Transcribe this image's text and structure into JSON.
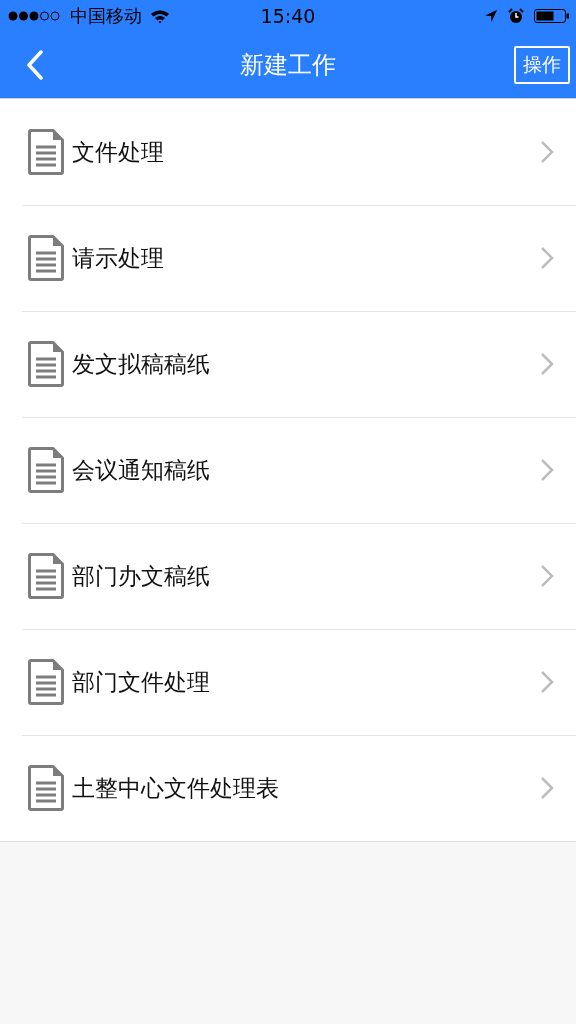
{
  "status_bar": {
    "carrier": "中国移动",
    "time": "15:40"
  },
  "nav_bar": {
    "title": "新建工作",
    "action": "操作"
  },
  "items": [
    {
      "label": "文件处理"
    },
    {
      "label": "请示处理"
    },
    {
      "label": "发文拟稿稿纸"
    },
    {
      "label": "会议通知稿纸"
    },
    {
      "label": "部门办文稿纸"
    },
    {
      "label": "部门文件处理"
    },
    {
      "label": "土整中心文件处理表"
    }
  ]
}
